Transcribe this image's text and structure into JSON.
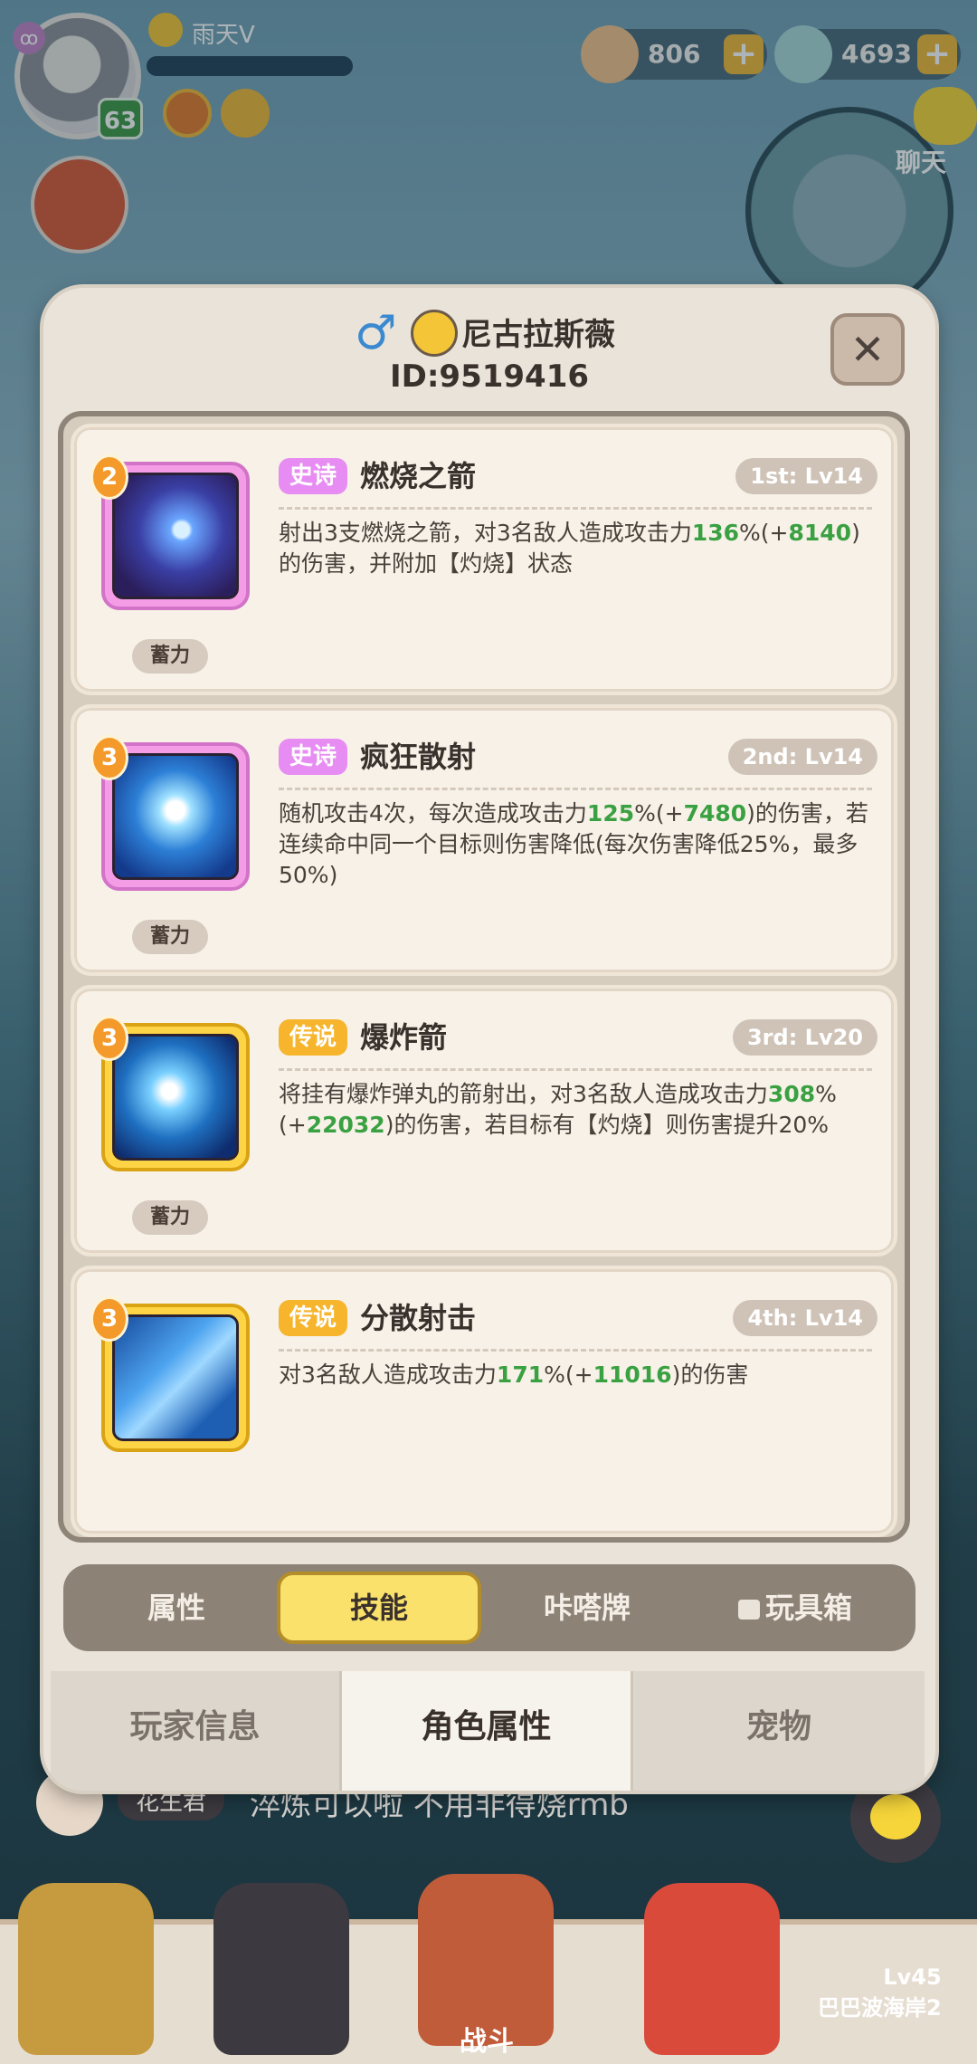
{
  "hud": {
    "player_name": "雨天V",
    "level": "63",
    "currency_1": "806",
    "currency_2": "4693",
    "chat_label": "聊天"
  },
  "panel": {
    "player_name": "尼古拉斯薇",
    "player_id": "ID:9519416",
    "close_label": "✕"
  },
  "skills": [
    {
      "level": "2",
      "rarity": "史诗",
      "name": "燃烧之箭",
      "slot": "1st: Lv14",
      "charge_tag": "蓄力",
      "desc_parts": [
        "射出3支燃烧之箭，对3名敌人造成攻击力",
        "136",
        "%(+",
        "8140",
        ")的伤害，并附加【灼烧】状态"
      ]
    },
    {
      "level": "3",
      "rarity": "史诗",
      "name": "疯狂散射",
      "slot": "2nd: Lv14",
      "charge_tag": "蓄力",
      "desc_parts": [
        "随机攻击4次，每次造成攻击力",
        "125",
        "%(+",
        "7480",
        ")的伤害，若连续命中同一个目标则伤害降低(每次伤害降低25%，最多50%)"
      ]
    },
    {
      "level": "3",
      "rarity": "传说",
      "name": "爆炸箭",
      "slot": "3rd: Lv20",
      "charge_tag": "蓄力",
      "desc_parts": [
        "将挂有爆炸弹丸的箭射出，对3名敌人造成攻击力",
        "308",
        "%(+",
        "22032",
        ")的伤害，若目标有【灼烧】则伤害提升20%"
      ]
    },
    {
      "level": "3",
      "rarity": "传说",
      "name": "分散射击",
      "slot": "4th: Lv14",
      "charge_tag": "",
      "desc_parts": [
        "对3名敌人造成攻击力",
        "171",
        "%(+",
        "11016",
        ")的伤害"
      ]
    }
  ],
  "subtabs": [
    "属性",
    "技能",
    "咔嗒牌",
    "玩具箱"
  ],
  "maintabs": [
    "玩家信息",
    "角色属性",
    "宠物"
  ],
  "chat": {
    "sender": "花生君",
    "message": "淬炼可以啦 不用非得烧rmb"
  },
  "bottom": {
    "battle_label": "战斗",
    "locked_level": "Lv45",
    "locked_name": "巴巴波海岸2"
  }
}
